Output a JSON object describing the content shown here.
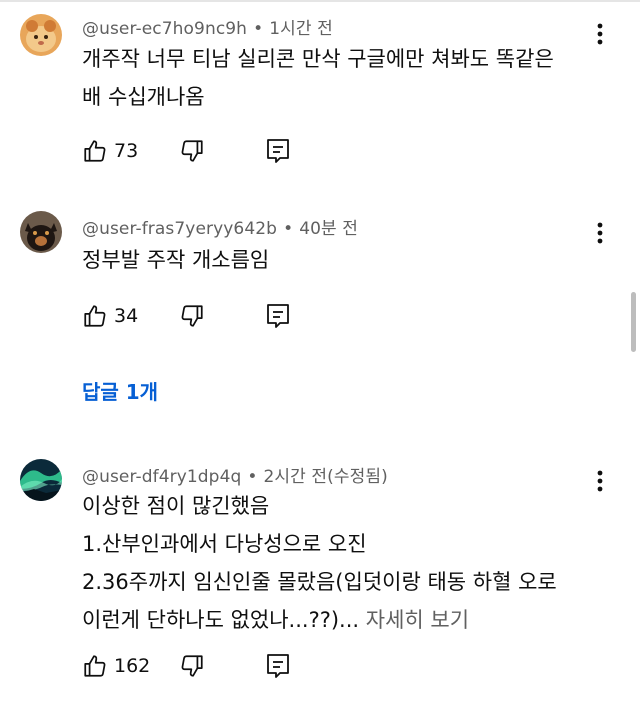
{
  "comments": [
    {
      "author": "@user-ec7ho9nc9h",
      "separator": "•",
      "time": "1시간 전",
      "text": "개주작 너무 티남 실리콘 만삭 구글에만 쳐봐도 똑같은\n배 수십개나옴",
      "more_label": "",
      "likes": "73",
      "avatar_icon": "hamster-avatar-icon"
    },
    {
      "author": "@user-fras7yeryy642b",
      "separator": "•",
      "time": "40분 전",
      "text": "정부발 주작 개소름임",
      "more_label": "",
      "likes": "34",
      "avatar_icon": "dog-avatar-icon",
      "replies_label": "답글 1개"
    },
    {
      "author": "@user-df4ry1dp4q",
      "separator": "•",
      "time": "2시간 전(수정됨)",
      "text": "이상한 점이 많긴했음\n1.산부인과에서 다낭성으로 오진\n2.36주까지 임신인줄 몰랐음(입덧이랑 태동 하혈 오로\n이런게 단하나도 없었나...??)... ",
      "more_label": "자세히 보기",
      "likes": "162",
      "avatar_icon": "aurora-avatar-icon"
    }
  ],
  "colors": {
    "link": "#065fd4",
    "meta": "#606060",
    "text": "#0f0f0f"
  }
}
